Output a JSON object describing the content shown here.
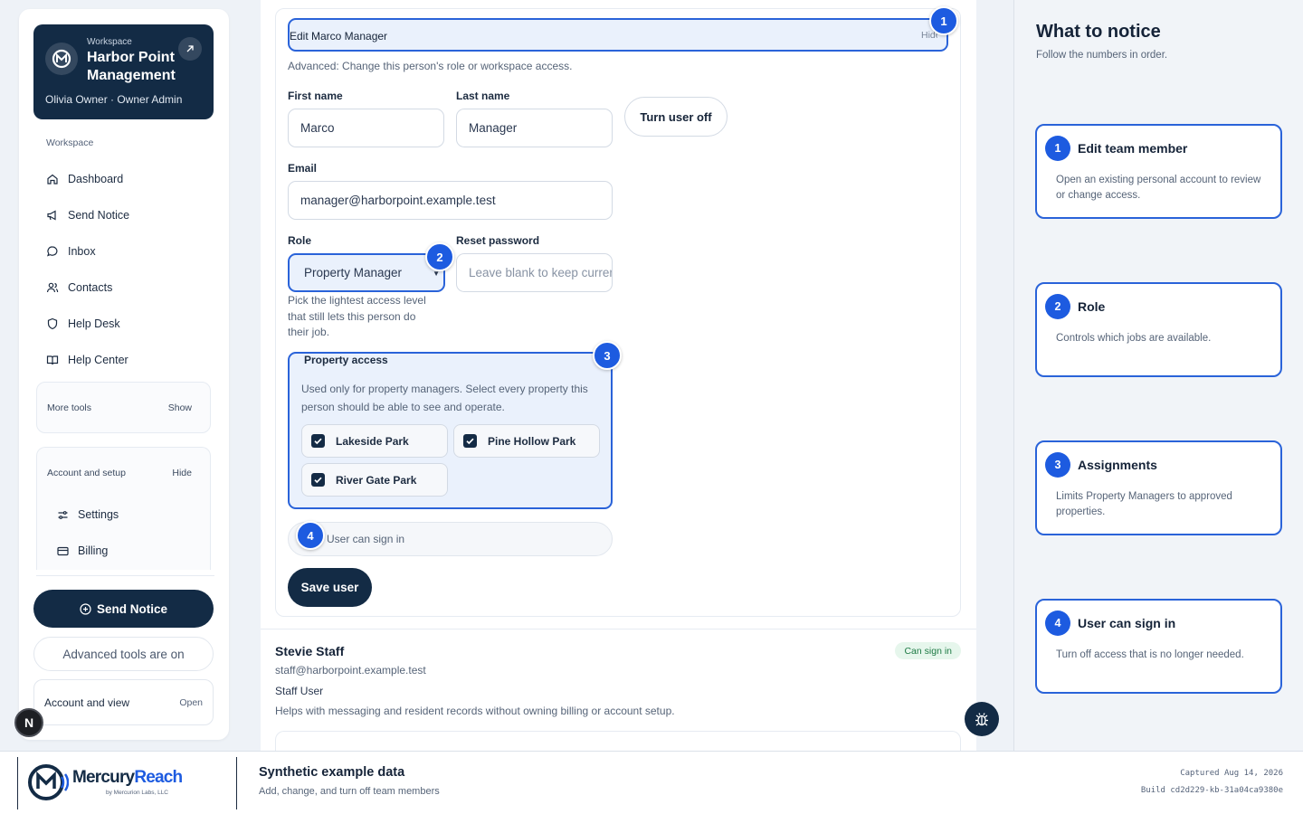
{
  "workspace": {
    "kicker": "Workspace",
    "name": "Harbor Point Management",
    "user": "Olivia Owner · Owner Admin"
  },
  "sidebar": {
    "section_label": "Workspace",
    "items": [
      {
        "label": "Dashboard",
        "icon": "home-icon"
      },
      {
        "label": "Send Notice",
        "icon": "megaphone-icon"
      },
      {
        "label": "Inbox",
        "icon": "chat-bubble-icon"
      },
      {
        "label": "Contacts",
        "icon": "users-icon"
      },
      {
        "label": "Help Desk",
        "icon": "shield-icon"
      },
      {
        "label": "Help Center",
        "icon": "book-icon"
      }
    ],
    "more_tools": {
      "label": "More tools",
      "toggle": "Show"
    },
    "account_setup": {
      "label": "Account and setup",
      "toggle": "Hide",
      "items": [
        {
          "label": "Settings",
          "icon": "sliders-icon"
        },
        {
          "label": "Billing",
          "icon": "credit-card-icon"
        }
      ]
    },
    "send_notice_button": "Send Notice",
    "advanced_pill": "Advanced tools are on",
    "account_view": {
      "label": "Account and view",
      "action": "Open"
    },
    "n_badge": "N"
  },
  "form": {
    "edit_title": "Edit Marco Manager",
    "edit_hide": "Hide",
    "edit_helper": "Advanced: Change this person's role or workspace access.",
    "first_name": {
      "label": "First name",
      "value": "Marco"
    },
    "last_name": {
      "label": "Last name",
      "value": "Manager"
    },
    "turn_off_button": "Turn user off",
    "email": {
      "label": "Email",
      "value": "manager@harborpoint.example.test"
    },
    "role": {
      "label": "Role",
      "value": "Property Manager",
      "helper": "Pick the lightest access level that still lets this person do their job."
    },
    "reset_password": {
      "label": "Reset password",
      "placeholder": "Leave blank to keep current password"
    },
    "property_access": {
      "legend": "Property access",
      "helper": "Used only for property managers. Select every property this person should be able to see and operate.",
      "properties": [
        {
          "label": "Lakeside Park",
          "checked": true
        },
        {
          "label": "Pine Hollow Park",
          "checked": true
        },
        {
          "label": "River Gate Park",
          "checked": true
        }
      ]
    },
    "signin_toggle": "User can sign in",
    "save_button": "Save user"
  },
  "markers": [
    "1",
    "2",
    "3",
    "4"
  ],
  "next_member": {
    "name": "Stevie Staff",
    "status": "Can sign in",
    "email": "staff@harborpoint.example.test",
    "role": "Staff User",
    "description": "Helps with messaging and resident records without owning billing or account setup."
  },
  "guide": {
    "title": "What to notice",
    "subtitle": "Follow the numbers in order.",
    "steps": [
      {
        "num": "1",
        "title": "Edit team member",
        "desc": "Open an existing personal account to review or change access."
      },
      {
        "num": "2",
        "title": "Role",
        "desc": "Controls which jobs are available."
      },
      {
        "num": "3",
        "title": "Assignments",
        "desc": "Limits Property Managers to approved properties."
      },
      {
        "num": "4",
        "title": "User can sign in",
        "desc": "Turn off access that is no longer needed."
      }
    ]
  },
  "footer": {
    "brand_mercury": "Mercury",
    "brand_reach": "Reach",
    "brand_by": "by Mercurion Labs, LLC",
    "title": "Synthetic example data",
    "subtitle": "Add, change, and turn off team members",
    "captured": "Captured Aug 14, 2026",
    "build": "Build cd2d229-kb-31a04ca9380e"
  },
  "colors": {
    "navy": "#132b45",
    "accent_blue": "#1d5be0",
    "highlight_fill": "#eaf1fc",
    "success_green": "#1e7a45"
  }
}
